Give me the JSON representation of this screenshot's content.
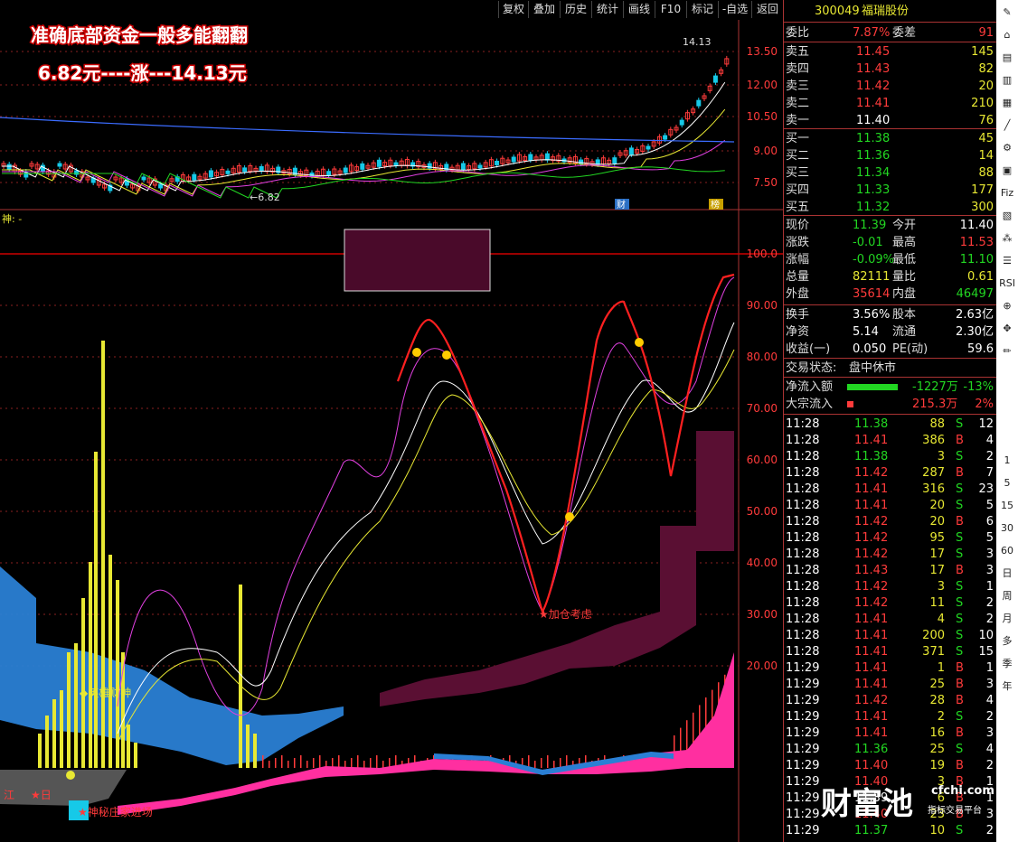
{
  "toolbar": [
    "复权",
    "叠加",
    "历史",
    "统计",
    "画线",
    "F10",
    "标记",
    "-自选",
    "返回"
  ],
  "overlay": {
    "line1": "准确底部资金一般多能翻翻",
    "line2": "6.82元----涨---14.13元"
  },
  "price_axis": [
    "13.50",
    "12.00",
    "10.50",
    "9.00",
    "7.50"
  ],
  "price_annotations": {
    "high": "14.13",
    "low": "6.82",
    "low_prefix": "←6.82",
    "marker_cai": "财",
    "marker_bang": "榜"
  },
  "indicator_title": "神: -",
  "indicator_axis": [
    "100.0",
    "90.00",
    "80.00",
    "70.00",
    "60.00",
    "50.00",
    "40.00",
    "30.00",
    "20.00"
  ],
  "indicator_labels": {
    "shen": "◆英雄财神",
    "jiacang": "★加仓考虑",
    "zhuang": "★神秘庄家进场",
    "left1": "江",
    "left2": "★日"
  },
  "stock": {
    "code": "300049",
    "name": "福瑞股份"
  },
  "weibi": {
    "label": "委比",
    "value": "7.87%",
    "label2": "委差",
    "value2": "91"
  },
  "asks": [
    {
      "label": "卖五",
      "price": "11.45",
      "vol": "145"
    },
    {
      "label": "卖四",
      "price": "11.43",
      "vol": "82"
    },
    {
      "label": "卖三",
      "price": "11.42",
      "vol": "20"
    },
    {
      "label": "卖二",
      "price": "11.41",
      "vol": "210"
    },
    {
      "label": "卖一",
      "price": "11.40",
      "vol": "76"
    }
  ],
  "bids": [
    {
      "label": "买一",
      "price": "11.38",
      "vol": "45"
    },
    {
      "label": "买二",
      "price": "11.36",
      "vol": "14"
    },
    {
      "label": "买三",
      "price": "11.34",
      "vol": "88"
    },
    {
      "label": "买四",
      "price": "11.33",
      "vol": "177"
    },
    {
      "label": "买五",
      "price": "11.32",
      "vol": "300"
    }
  ],
  "quote": [
    {
      "l1": "现价",
      "v1": "11.39",
      "l2": "今开",
      "v2": "11.40",
      "c1": "grn",
      "c2": "wht"
    },
    {
      "l1": "涨跌",
      "v1": "-0.01",
      "l2": "最高",
      "v2": "11.53",
      "c1": "grn",
      "c2": "red"
    },
    {
      "l1": "涨幅",
      "v1": "-0.09%",
      "l2": "最低",
      "v2": "11.10",
      "c1": "grn",
      "c2": "grn"
    },
    {
      "l1": "总量",
      "v1": "82111",
      "l2": "量比",
      "v2": "0.61",
      "c1": "yel",
      "c2": "yel"
    },
    {
      "l1": "外盘",
      "v1": "35614",
      "l2": "内盘",
      "v2": "46497",
      "c1": "red",
      "c2": "grn"
    }
  ],
  "fundamentals": [
    {
      "l1": "换手",
      "v1": "3.56%",
      "l2": "股本",
      "v2": "2.63亿"
    },
    {
      "l1": "净资",
      "v1": "5.14",
      "l2": "流通",
      "v2": "2.30亿"
    },
    {
      "l1": "收益(一)",
      "v1": "0.050",
      "l2": "PE(动)",
      "v2": "59.6"
    }
  ],
  "trade_status": {
    "label": "交易状态:",
    "value": "盘中休市"
  },
  "flows": [
    {
      "label": "净流入额",
      "value": "-1227万",
      "pct": "-13%",
      "color": "#22d622",
      "vcls": "grn"
    },
    {
      "label": "大宗流入",
      "value": "215.3万",
      "pct": "2%",
      "color": "#ff3b3b",
      "vcls": "red"
    }
  ],
  "ticks": [
    {
      "t": "11:28",
      "p": "11.38",
      "v": "88",
      "s": "S",
      "n": "12"
    },
    {
      "t": "11:28",
      "p": "11.41",
      "v": "386",
      "s": "B",
      "n": "4"
    },
    {
      "t": "11:28",
      "p": "11.38",
      "v": "3",
      "s": "S",
      "n": "2"
    },
    {
      "t": "11:28",
      "p": "11.42",
      "v": "287",
      "s": "B",
      "n": "7"
    },
    {
      "t": "11:28",
      "p": "11.41",
      "v": "316",
      "s": "S",
      "n": "23"
    },
    {
      "t": "11:28",
      "p": "11.41",
      "v": "20",
      "s": "S",
      "n": "5"
    },
    {
      "t": "11:28",
      "p": "11.42",
      "v": "20",
      "s": "B",
      "n": "6"
    },
    {
      "t": "11:28",
      "p": "11.42",
      "v": "95",
      "s": "S",
      "n": "5"
    },
    {
      "t": "11:28",
      "p": "11.42",
      "v": "17",
      "s": "S",
      "n": "3"
    },
    {
      "t": "11:28",
      "p": "11.43",
      "v": "17",
      "s": "B",
      "n": "3"
    },
    {
      "t": "11:28",
      "p": "11.42",
      "v": "3",
      "s": "S",
      "n": "1"
    },
    {
      "t": "11:28",
      "p": "11.42",
      "v": "11",
      "s": "S",
      "n": "2"
    },
    {
      "t": "11:28",
      "p": "11.41",
      "v": "4",
      "s": "S",
      "n": "2"
    },
    {
      "t": "11:28",
      "p": "11.41",
      "v": "200",
      "s": "S",
      "n": "10"
    },
    {
      "t": "11:28",
      "p": "11.41",
      "v": "371",
      "s": "S",
      "n": "15"
    },
    {
      "t": "11:29",
      "p": "11.41",
      "v": "1",
      "s": "B",
      "n": "1"
    },
    {
      "t": "11:29",
      "p": "11.41",
      "v": "25",
      "s": "B",
      "n": "3"
    },
    {
      "t": "11:29",
      "p": "11.42",
      "v": "28",
      "s": "B",
      "n": "4"
    },
    {
      "t": "11:29",
      "p": "11.41",
      "v": "2",
      "s": "S",
      "n": "2"
    },
    {
      "t": "11:29",
      "p": "11.41",
      "v": "16",
      "s": "B",
      "n": "3"
    },
    {
      "t": "11:29",
      "p": "11.36",
      "v": "25",
      "s": "S",
      "n": "4"
    },
    {
      "t": "11:29",
      "p": "11.40",
      "v": "19",
      "s": "B",
      "n": "2"
    },
    {
      "t": "11:29",
      "p": "11.40",
      "v": "3",
      "s": "B",
      "n": "1"
    },
    {
      "t": "11:29",
      "p": "11.39",
      "v": "6",
      "s": "B",
      "n": "1"
    },
    {
      "t": "11:29",
      "p": "11.40",
      "v": "23",
      "s": "B",
      "n": "3"
    },
    {
      "t": "11:29",
      "p": "11.37",
      "v": "10",
      "s": "S",
      "n": "2"
    }
  ],
  "watermark": {
    "big": "财富池",
    "site": "cfchi.com",
    "sub": "指标交易平台"
  },
  "side_strip": [
    "1",
    "5",
    "15",
    "30",
    "60",
    "日",
    "周",
    "月",
    "多",
    "季",
    "年"
  ]
}
